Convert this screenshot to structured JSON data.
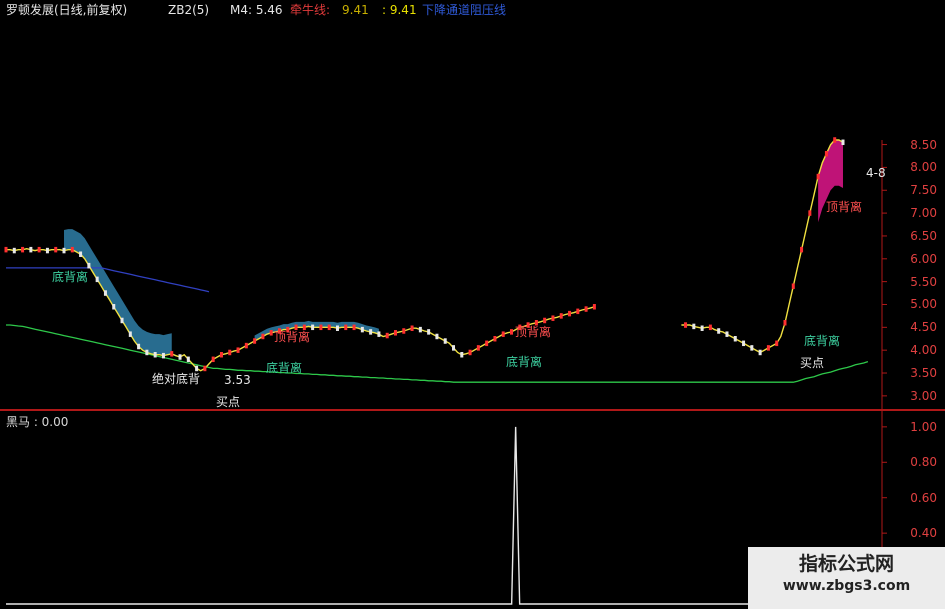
{
  "header": {
    "title": "罗顿发展(日线,前复权)",
    "zb2": "ZB2(5)",
    "m4": "M4: 5.46",
    "ma_label": "牵牛线:",
    "ma_v1": "9.41",
    "ma_v2": ": 9.41",
    "line_label": "下降通道阻压线"
  },
  "sub_title": "黑马 : 0.00",
  "annotations": [
    {
      "id": "a1",
      "text": "底背离",
      "color": "#3dd0a0"
    },
    {
      "id": "a2",
      "text": "绝对底背",
      "color": "#e8e8e8"
    },
    {
      "id": "a3",
      "text": "3.53",
      "color": "#e8e8e8"
    },
    {
      "id": "a4",
      "text": "买点",
      "color": "#e8e8e8"
    },
    {
      "id": "a5",
      "text": "底背离",
      "color": "#3dd0a0"
    },
    {
      "id": "a6",
      "text": "顶背离",
      "color": "#ff5050"
    },
    {
      "id": "a7",
      "text": "顶背离",
      "color": "#ff5050"
    },
    {
      "id": "a8",
      "text": "底背离",
      "color": "#3dd0a0"
    },
    {
      "id": "a9",
      "text": "顶背离",
      "color": "#ff5050"
    },
    {
      "id": "a10",
      "text": "底背离",
      "color": "#3dd0a0"
    },
    {
      "id": "a11",
      "text": "买点",
      "color": "#e8e8e8"
    },
    {
      "id": "a12",
      "text": "4-8",
      "color": "#e8e8e8"
    }
  ],
  "watermark": {
    "line1": "指标公式网",
    "line2": "www.zbgs3.com"
  },
  "colors": {
    "background": "#000000",
    "axis": "#b01818",
    "up": "#ff3030",
    "down": "#e8e8e8",
    "fill_blue": "#2f7fa8",
    "fill_magenta": "#e0168c",
    "green_line": "#2ec84a",
    "yellow_line": "#f0e040"
  },
  "chart_data": [
    {
      "type": "line",
      "ylim": [
        2.8,
        8.6
      ],
      "yticks": [
        "8.50",
        "8.00",
        "7.50",
        "7.00",
        "6.50",
        "6.00",
        "5.50",
        "5.00",
        "4.50",
        "4.00",
        "3.50",
        "3.00"
      ],
      "x": [
        0,
        1,
        2,
        3,
        4,
        5,
        6,
        7,
        8,
        9,
        10,
        11,
        12,
        13,
        14,
        15,
        16,
        17,
        18,
        19,
        20,
        21,
        22,
        23,
        24,
        25,
        26,
        27,
        28,
        29,
        30,
        31,
        32,
        33,
        34,
        35,
        36,
        37,
        38,
        39,
        40,
        41,
        42,
        43,
        44,
        45,
        46,
        47,
        48,
        49,
        50,
        51,
        52,
        53,
        54,
        55,
        56,
        57,
        58,
        59,
        60,
        61,
        62,
        63,
        64,
        65,
        66,
        67,
        68,
        69,
        70,
        71,
        72,
        73,
        74,
        75,
        76,
        77,
        78,
        79,
        80,
        81,
        82,
        83,
        84,
        85,
        86,
        87,
        88,
        89,
        90,
        91,
        92,
        93,
        94,
        95,
        96,
        97,
        98,
        99,
        100,
        101,
        102,
        103,
        104,
        105,
        106,
        107,
        108,
        109,
        110,
        111,
        112,
        113,
        114,
        115,
        116,
        117,
        118,
        119,
        120,
        121,
        122,
        123,
        124,
        125,
        126,
        127,
        128,
        129,
        130,
        131,
        132,
        133,
        134,
        135,
        136,
        137,
        138,
        139,
        140,
        141,
        142,
        143,
        144,
        145,
        146,
        147,
        148,
        149,
        150,
        151,
        152,
        153,
        154,
        155,
        156,
        157,
        158,
        159,
        160,
        161,
        162,
        163,
        164,
        165,
        166,
        167,
        168,
        169,
        170,
        171,
        172,
        173,
        174,
        175,
        176,
        177,
        178,
        179,
        180,
        181,
        182,
        183,
        184,
        185,
        186,
        187,
        188,
        189,
        190,
        191,
        192,
        193,
        194,
        195,
        196,
        197,
        198,
        199,
        200,
        201,
        202,
        203,
        204,
        205,
        206,
        207,
        208,
        209
      ],
      "series": [
        {
          "name": "price",
          "values": [
            6.2,
            6.2,
            6.18,
            6.2,
            6.2,
            6.22,
            6.2,
            6.18,
            6.2,
            6.2,
            6.18,
            6.2,
            6.2,
            6.2,
            6.18,
            6.2,
            6.2,
            6.15,
            6.1,
            6.0,
            5.85,
            5.7,
            5.55,
            5.4,
            5.25,
            5.1,
            4.95,
            4.8,
            4.65,
            4.5,
            4.35,
            4.2,
            4.08,
            4.0,
            3.95,
            3.92,
            3.9,
            3.9,
            3.88,
            3.9,
            3.92,
            3.88,
            3.85,
            3.9,
            3.8,
            3.7,
            3.6,
            3.55,
            3.6,
            3.7,
            3.8,
            3.85,
            3.9,
            3.92,
            3.95,
            3.98,
            4.0,
            4.05,
            4.1,
            4.15,
            4.2,
            4.25,
            4.3,
            4.35,
            4.38,
            4.4,
            4.42,
            4.45,
            4.45,
            4.48,
            4.5,
            4.5,
            4.5,
            4.52,
            4.5,
            4.5,
            4.5,
            4.5,
            4.5,
            4.5,
            4.48,
            4.5,
            4.5,
            4.5,
            4.5,
            4.48,
            4.45,
            4.42,
            4.4,
            4.38,
            4.35,
            4.3,
            4.32,
            4.35,
            4.38,
            4.4,
            4.42,
            4.45,
            4.48,
            4.48,
            4.45,
            4.42,
            4.4,
            4.35,
            4.3,
            4.25,
            4.2,
            4.15,
            4.05,
            3.95,
            3.9,
            3.92,
            3.95,
            4.0,
            4.05,
            4.1,
            4.15,
            4.2,
            4.25,
            4.3,
            4.35,
            4.38,
            4.4,
            4.45,
            4.5,
            4.52,
            4.55,
            4.58,
            4.6,
            4.62,
            4.65,
            4.68,
            4.7,
            4.72,
            4.75,
            4.78,
            4.8,
            4.82,
            4.85,
            4.88,
            4.9,
            4.92,
            4.95,
            null,
            null,
            null,
            null,
            null,
            null,
            null,
            null,
            null,
            null,
            null,
            null,
            null,
            null,
            null,
            null,
            null,
            null,
            null,
            null,
            4.55,
            4.55,
            4.55,
            4.52,
            4.5,
            4.48,
            4.5,
            4.5,
            4.45,
            4.42,
            4.4,
            4.35,
            4.3,
            4.25,
            4.2,
            4.15,
            4.1,
            4.05,
            4.0,
            3.95,
            4.0,
            4.05,
            4.1,
            4.15,
            4.3,
            4.6,
            5.0,
            5.4,
            5.8,
            6.2,
            6.6,
            7.0,
            7.4,
            7.8,
            8.1,
            8.3,
            8.5,
            8.6,
            8.6,
            8.55
          ]
        },
        {
          "name": "green",
          "values": [
            4.55,
            4.55,
            4.54,
            4.53,
            4.52,
            4.5,
            4.48,
            4.46,
            4.44,
            4.42,
            4.4,
            4.38,
            4.36,
            4.34,
            4.32,
            4.3,
            4.28,
            4.26,
            4.24,
            4.22,
            4.2,
            4.18,
            4.16,
            4.14,
            4.12,
            4.1,
            4.08,
            4.06,
            4.04,
            4.02,
            4.0,
            3.98,
            3.96,
            3.94,
            3.92,
            3.9,
            3.88,
            3.86,
            3.84,
            3.82,
            3.8,
            3.78,
            3.76,
            3.74,
            3.72,
            3.7,
            3.68,
            3.66,
            3.64,
            3.62,
            3.6,
            3.6,
            3.59,
            3.58,
            3.58,
            3.57,
            3.56,
            3.56,
            3.55,
            3.55,
            3.54,
            3.54,
            3.53,
            3.53,
            3.52,
            3.52,
            3.51,
            3.51,
            3.5,
            3.5,
            3.49,
            3.49,
            3.48,
            3.48,
            3.47,
            3.47,
            3.46,
            3.46,
            3.45,
            3.45,
            3.44,
            3.44,
            3.43,
            3.43,
            3.42,
            3.42,
            3.41,
            3.41,
            3.4,
            3.4,
            3.39,
            3.39,
            3.38,
            3.38,
            3.37,
            3.37,
            3.36,
            3.36,
            3.35,
            3.35,
            3.34,
            3.34,
            3.33,
            3.33,
            3.32,
            3.32,
            3.31,
            3.31,
            3.3,
            3.3,
            3.3,
            3.3,
            3.3,
            3.3,
            3.3,
            3.3,
            3.3,
            3.3,
            3.3,
            3.3,
            3.3,
            3.3,
            3.3,
            3.3,
            3.3,
            3.3,
            3.3,
            3.3,
            3.3,
            3.3,
            3.3,
            3.3,
            3.3,
            3.3,
            3.3,
            3.3,
            3.3,
            3.3,
            3.3,
            3.3,
            3.3,
            3.3,
            3.3,
            3.3,
            3.3,
            3.3,
            3.3,
            3.3,
            3.3,
            3.3,
            3.3,
            3.3,
            3.3,
            3.3,
            3.3,
            3.3,
            3.3,
            3.3,
            3.3,
            3.3,
            3.3,
            3.3,
            3.3,
            3.3,
            3.3,
            3.3,
            3.3,
            3.3,
            3.3,
            3.3,
            3.3,
            3.3,
            3.3,
            3.3,
            3.3,
            3.3,
            3.3,
            3.3,
            3.3,
            3.3,
            3.3,
            3.3,
            3.3,
            3.3,
            3.3,
            3.3,
            3.3,
            3.3,
            3.3,
            3.3,
            3.3,
            3.32,
            3.35,
            3.38,
            3.4,
            3.42,
            3.45,
            3.48,
            3.5,
            3.52,
            3.55,
            3.58,
            3.6,
            3.62,
            3.65,
            3.68,
            3.7,
            3.72,
            3.75
          ]
        },
        {
          "name": "blue",
          "values": [
            5.8,
            5.8,
            5.8,
            5.8,
            5.8,
            5.8,
            5.8,
            5.8,
            5.8,
            5.8,
            5.8,
            5.8,
            5.8,
            5.8,
            5.8,
            5.8,
            5.8,
            5.8,
            5.8,
            5.8,
            5.8,
            5.8,
            5.8,
            5.8,
            5.78,
            5.76,
            5.74,
            5.72,
            5.7,
            5.68,
            5.66,
            5.64,
            5.62,
            5.6,
            5.58,
            5.56,
            5.54,
            5.52,
            5.5,
            5.48,
            5.46,
            5.44,
            5.42,
            5.4,
            5.38,
            5.36,
            5.34,
            5.32,
            5.3,
            5.28,
            null,
            null,
            null,
            null,
            null,
            null,
            null,
            null,
            null,
            null,
            null,
            null,
            null,
            null,
            null,
            null,
            null,
            null,
            null,
            null,
            null,
            null,
            null,
            null,
            null,
            null,
            null,
            null,
            null,
            null,
            null,
            null,
            null,
            null,
            null,
            null,
            null,
            null,
            null,
            null,
            null,
            null,
            null,
            null,
            null,
            null,
            null,
            null,
            null,
            null,
            null,
            null,
            null,
            null,
            null,
            null,
            null,
            null,
            null,
            null,
            null,
            null,
            null,
            null,
            null,
            null,
            null,
            null,
            null,
            null,
            null,
            null,
            null,
            null,
            null,
            null,
            null,
            null,
            null,
            null,
            null,
            null,
            null,
            null,
            null,
            null,
            null,
            null,
            null,
            null,
            null,
            null,
            null,
            null,
            null,
            null,
            null,
            null,
            null,
            null,
            null,
            null,
            null,
            null,
            null,
            null,
            null,
            null,
            null,
            null,
            null,
            null,
            null,
            null,
            null,
            null,
            null,
            null,
            null,
            null,
            null,
            null,
            null,
            null,
            null,
            null,
            null,
            null,
            null,
            null,
            null,
            null,
            null,
            null,
            null,
            null,
            null,
            null,
            null,
            null,
            null,
            null,
            null,
            null,
            null,
            null,
            null,
            null,
            null,
            null,
            null,
            null,
            null,
            null,
            null,
            null,
            null,
            null,
            null,
            null,
            null,
            null,
            null,
            null,
            null,
            null
          ]
        }
      ]
    },
    {
      "type": "line",
      "title": "黑马",
      "ylim": [
        0,
        1.05
      ],
      "yticks": [
        "1.00",
        "0.80",
        "0.60",
        "0.40"
      ],
      "spike_x": 123,
      "spike_value": 1.0,
      "baseline": 0
    }
  ]
}
